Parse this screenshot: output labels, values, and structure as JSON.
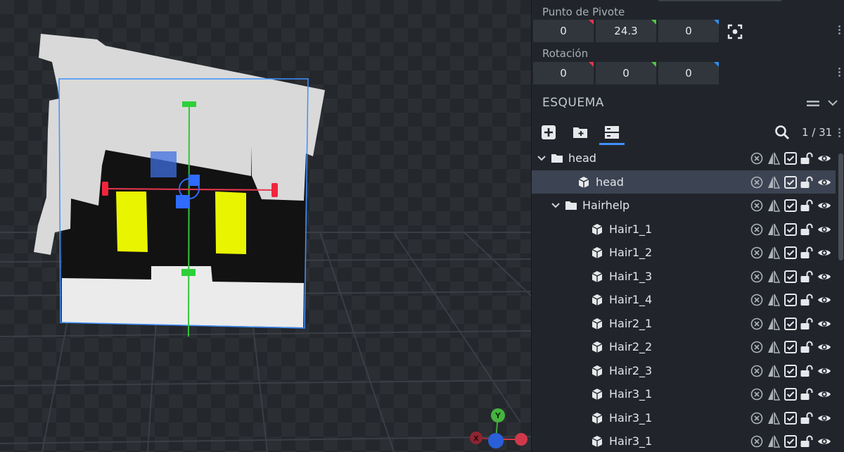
{
  "pivot": {
    "label": "Punto de Pivote",
    "x": "0",
    "y": "24.3",
    "z": "0"
  },
  "rotation": {
    "label": "Rotación",
    "x": "0",
    "y": "0",
    "z": "0"
  },
  "outliner": {
    "title": "ESQUEMA",
    "count": "1 / 31",
    "items": [
      {
        "name": "head",
        "type": "folder",
        "depth": 0,
        "expanded": true,
        "selected": false
      },
      {
        "name": "head",
        "type": "cube",
        "depth": 1,
        "selected": true
      },
      {
        "name": "Hairhelp",
        "type": "folder",
        "depth": 1,
        "expanded": true,
        "selected": false
      },
      {
        "name": "Hair1_1",
        "type": "cube",
        "depth": 2,
        "selected": false
      },
      {
        "name": "Hair1_2",
        "type": "cube",
        "depth": 2,
        "selected": false
      },
      {
        "name": "Hair1_3",
        "type": "cube",
        "depth": 2,
        "selected": false
      },
      {
        "name": "Hair1_4",
        "type": "cube",
        "depth": 2,
        "selected": false
      },
      {
        "name": "Hair2_1",
        "type": "cube",
        "depth": 2,
        "selected": false
      },
      {
        "name": "Hair2_2",
        "type": "cube",
        "depth": 2,
        "selected": false
      },
      {
        "name": "Hair2_3",
        "type": "cube",
        "depth": 2,
        "selected": false
      },
      {
        "name": "Hair3_1",
        "type": "cube",
        "depth": 2,
        "selected": false
      },
      {
        "name": "Hair3_1",
        "type": "cube",
        "depth": 2,
        "selected": false
      },
      {
        "name": "Hair3_1",
        "type": "cube",
        "depth": 2,
        "selected": false
      }
    ]
  },
  "gizmo": {
    "y": "Y",
    "x": "X"
  },
  "colors": {
    "axis_x": "#e8364f",
    "axis_y": "#4ec940",
    "axis_z": "#2f8ef0",
    "selection": "#3c4352",
    "accent": "#3e90ff"
  }
}
